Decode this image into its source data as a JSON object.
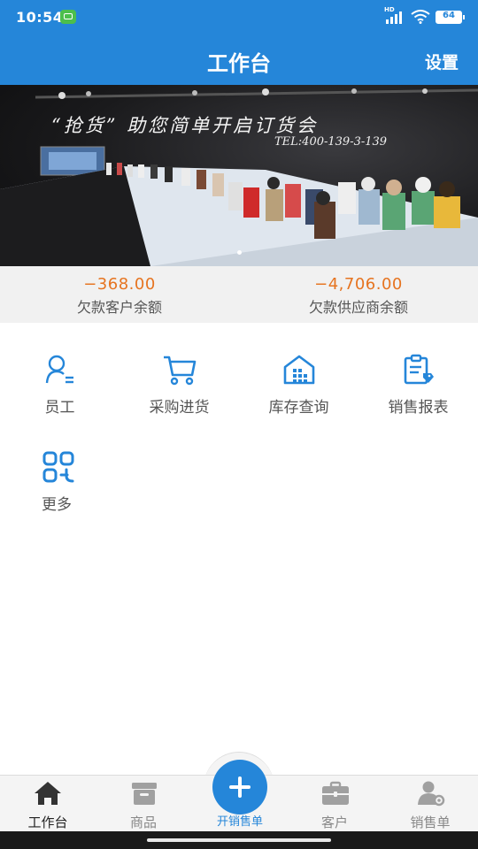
{
  "status_bar": {
    "time": "10:54",
    "network_label": "HD",
    "battery": "64"
  },
  "header": {
    "title": "工作台",
    "settings_label": "设置"
  },
  "banner": {
    "headline": "“抢货” 助您简单开启订货会",
    "tel": "TEL:400-139-3-139"
  },
  "balances": [
    {
      "amount": "−368.00",
      "label": "欠款客户余额"
    },
    {
      "amount": "−4,706.00",
      "label": "欠款供应商余额"
    }
  ],
  "grid": [
    {
      "label": "员工",
      "icon": "person-icon"
    },
    {
      "label": "采购进货",
      "icon": "cart-icon"
    },
    {
      "label": "库存查询",
      "icon": "warehouse-icon"
    },
    {
      "label": "销售报表",
      "icon": "report-icon"
    },
    {
      "label": "更多",
      "icon": "more-grid-icon"
    }
  ],
  "tabbar": {
    "tabs": [
      {
        "label": "工作台",
        "icon": "home-icon",
        "active": true
      },
      {
        "label": "商品",
        "icon": "box-icon"
      },
      {
        "label": "开销售单",
        "icon": "plus-icon"
      },
      {
        "label": "客户",
        "icon": "briefcase-icon"
      },
      {
        "label": "销售单",
        "icon": "user-gear-icon"
      }
    ]
  },
  "colors": {
    "primary": "#2586d9",
    "amount": "#e67420",
    "tab_active": "#222222",
    "tab_inactive": "#888888"
  }
}
